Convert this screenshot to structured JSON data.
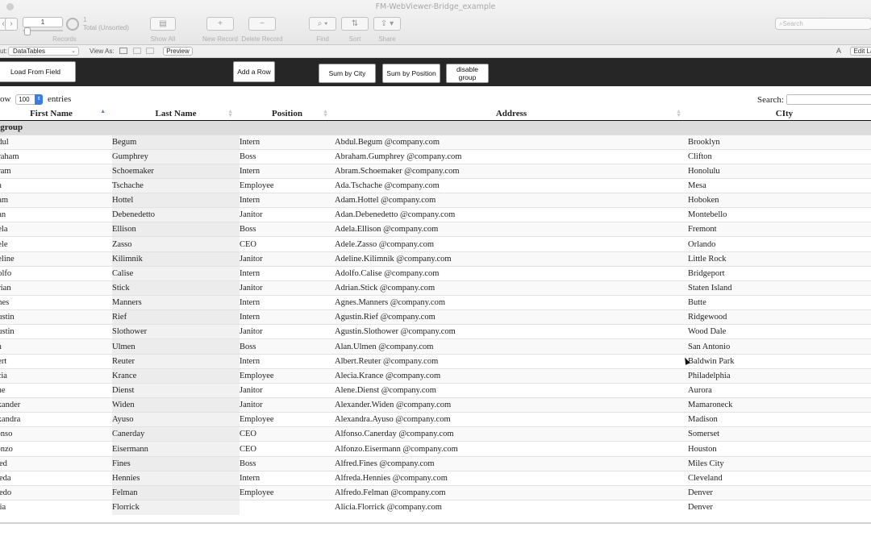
{
  "window": {
    "title": "FM-WebViewer-Bridge_example"
  },
  "toolbar": {
    "record_current": "1",
    "record_total": "1",
    "total_label": "Total (Unsorted)",
    "records_label": "Records",
    "show_all": "Show All",
    "new_record": "New Record",
    "delete_record": "Delete Record",
    "find": "Find",
    "sort": "Sort",
    "share": "Share",
    "search_placeholder": "Search"
  },
  "layout_bar": {
    "layout_label": "ut:",
    "layout_value": "DataTables",
    "view_as": "View As:",
    "preview": "Preview",
    "edit_layout": "Edit La",
    "font_icon": "A"
  },
  "webviewer_buttons": {
    "load_from_field": "Load From Field",
    "add_row": "Add a Row",
    "sum_by_city": "Sum by City",
    "sum_by_position": "Sum by Position",
    "disable_group_1": "disable",
    "disable_group_2": "group"
  },
  "table_controls": {
    "show_label": "ow",
    "length_value": "100",
    "entries_label": "entries",
    "search_label": "Search:"
  },
  "columns": [
    "First Name",
    "Last Name",
    "Position",
    "Address",
    "CIty"
  ],
  "group_label": "o group",
  "rows": [
    [
      "bdul",
      "Begum",
      "Intern",
      "Abdul.Begum @company.com",
      "Brooklyn"
    ],
    [
      "braham",
      "Gumphrey",
      "Boss",
      "Abraham.Gumphrey @company.com",
      "Clifton"
    ],
    [
      "bram",
      "Schoemaker",
      "Intern",
      "Abram.Schoemaker @company.com",
      "Honolulu"
    ],
    [
      "da",
      "Tschache",
      "Employee",
      "Ada.Tschache @company.com",
      "Mesa"
    ],
    [
      "dam",
      "Hottel",
      "Intern",
      "Adam.Hottel @company.com",
      "Hoboken"
    ],
    [
      "dan",
      "Debenedetto",
      "Janitor",
      "Adan.Debenedetto @company.com",
      "Montebello"
    ],
    [
      "dela",
      "Ellison",
      "Boss",
      "Adela.Ellison @company.com",
      "Fremont"
    ],
    [
      "dele",
      "Zasso",
      "CEO",
      "Adele.Zasso @company.com",
      "Orlando"
    ],
    [
      "deline",
      "Kilimnik",
      "Janitor",
      "Adeline.Kilimnik @company.com",
      "Little Rock"
    ],
    [
      "dolfo",
      "Calise",
      "Intern",
      "Adolfo.Calise @company.com",
      "Bridgeport"
    ],
    [
      "drian",
      "Stick",
      "Janitor",
      "Adrian.Stick @company.com",
      "Staten Island"
    ],
    [
      "gnes",
      "Manners",
      "Intern",
      "Agnes.Manners @company.com",
      "Butte"
    ],
    [
      "gustin",
      "Rief",
      "Intern",
      "Agustin.Rief @company.com",
      "Ridgewood"
    ],
    [
      "gustin",
      "Slothower",
      "Janitor",
      "Agustin.Slothower @company.com",
      "Wood Dale"
    ],
    [
      "an",
      "Ulmen",
      "Boss",
      "Alan.Ulmen @company.com",
      "San Antonio"
    ],
    [
      "bert",
      "Reuter",
      "Intern",
      "Albert.Reuter @company.com",
      "Baldwin Park"
    ],
    [
      "ecia",
      "Krance",
      "Employee",
      "Alecia.Krance @company.com",
      "Philadelphia"
    ],
    [
      "ene",
      "Dienst",
      "Janitor",
      "Alene.Dienst @company.com",
      "Aurora"
    ],
    [
      "exander",
      "Widen",
      "Janitor",
      "Alexander.Widen @company.com",
      "Mamaroneck"
    ],
    [
      "exandra",
      "Ayuso",
      "Employee",
      "Alexandra.Ayuso @company.com",
      "Madison"
    ],
    [
      "fonso",
      "Canerday",
      "CEO",
      "Alfonso.Canerday @company.com",
      "Somerset"
    ],
    [
      "fonzo",
      "Eisermann",
      "CEO",
      "Alfonzo.Eisermann @company.com",
      "Houston"
    ],
    [
      "fred",
      "Fines",
      "Boss",
      "Alfred.Fines @company.com",
      "Miles City"
    ],
    [
      "freda",
      "Hennies",
      "Intern",
      "Alfreda.Hennies @company.com",
      "Cleveland"
    ],
    [
      "fredo",
      "Felman",
      "Employee",
      "Alfredo.Felman @company.com",
      "Denver"
    ],
    [
      "icia",
      "Florrick",
      "",
      "Alicia.Florrick @company.com",
      "Denver"
    ]
  ],
  "colors": {
    "dark_header": "#262626",
    "group_row": "#dcdcdc",
    "select_accent": "#3a7de4"
  }
}
